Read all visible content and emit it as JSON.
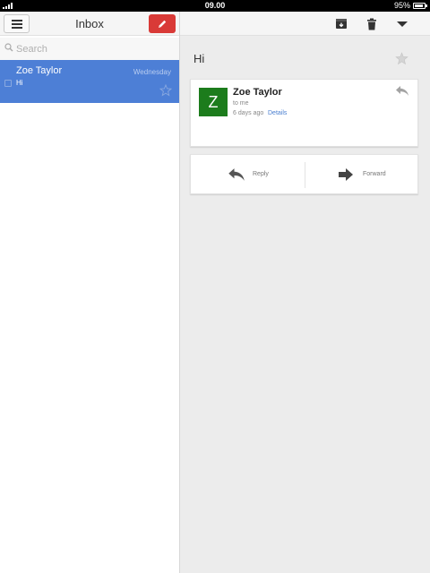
{
  "status_bar": {
    "time": "09.00",
    "battery": "95%"
  },
  "inbox": {
    "title": "Inbox",
    "search_placeholder": "Search",
    "messages": [
      {
        "sender": "Zoe Taylor",
        "date": "Wednesday",
        "snippet": "Hi",
        "selected": true
      }
    ]
  },
  "message_view": {
    "subject": "Hi",
    "sender": "Zoe Taylor",
    "avatar_letter": "Z",
    "avatar_color": "#1c7c1c",
    "recipient": "to me",
    "time": "6 days ago",
    "details_link": "Details",
    "actions": {
      "reply_label": "Reply",
      "forward_label": "Forward"
    }
  },
  "colors": {
    "selected_row": "#4d7fd6",
    "compose_button": "#d93a37",
    "link": "#4a7fd0"
  },
  "icons": {
    "menu": "menu-icon",
    "compose": "pencil-icon",
    "search": "search-icon",
    "archive": "archive-icon",
    "delete": "trash-icon",
    "more": "chevron-down-icon",
    "star": "star-icon",
    "reply": "reply-icon",
    "forward": "forward-icon"
  }
}
